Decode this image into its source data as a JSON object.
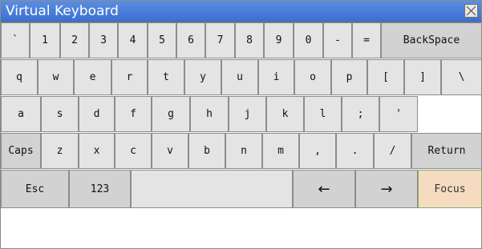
{
  "window": {
    "title": "Virtual Keyboard",
    "close_icon": "close-icon"
  },
  "keyboard": {
    "rows": [
      [
        {
          "id": "backtick",
          "label": "`"
        },
        {
          "id": "1",
          "label": "1"
        },
        {
          "id": "2",
          "label": "2"
        },
        {
          "id": "3",
          "label": "3"
        },
        {
          "id": "4",
          "label": "4"
        },
        {
          "id": "5",
          "label": "5"
        },
        {
          "id": "6",
          "label": "6"
        },
        {
          "id": "7",
          "label": "7"
        },
        {
          "id": "8",
          "label": "8"
        },
        {
          "id": "9",
          "label": "9"
        },
        {
          "id": "0",
          "label": "0"
        },
        {
          "id": "minus",
          "label": "-"
        },
        {
          "id": "equals",
          "label": "="
        },
        {
          "id": "backspace",
          "label": "BackSpace",
          "special": true
        }
      ],
      [
        {
          "id": "q",
          "label": "q"
        },
        {
          "id": "w",
          "label": "w"
        },
        {
          "id": "e",
          "label": "e"
        },
        {
          "id": "r",
          "label": "r"
        },
        {
          "id": "t",
          "label": "t"
        },
        {
          "id": "y",
          "label": "y"
        },
        {
          "id": "u",
          "label": "u"
        },
        {
          "id": "i",
          "label": "i"
        },
        {
          "id": "o",
          "label": "o"
        },
        {
          "id": "p",
          "label": "p"
        },
        {
          "id": "left-bracket",
          "label": "["
        },
        {
          "id": "right-bracket",
          "label": "]"
        },
        {
          "id": "backslash",
          "label": "\\"
        }
      ],
      [
        {
          "id": "a",
          "label": "a"
        },
        {
          "id": "s",
          "label": "s"
        },
        {
          "id": "d",
          "label": "d"
        },
        {
          "id": "f",
          "label": "f"
        },
        {
          "id": "g",
          "label": "g"
        },
        {
          "id": "h",
          "label": "h"
        },
        {
          "id": "j",
          "label": "j"
        },
        {
          "id": "k",
          "label": "k"
        },
        {
          "id": "l",
          "label": "l"
        },
        {
          "id": "semicolon",
          "label": ";"
        },
        {
          "id": "quote",
          "label": "'"
        }
      ],
      [
        {
          "id": "caps",
          "label": "Caps",
          "special": true
        },
        {
          "id": "z",
          "label": "z"
        },
        {
          "id": "x",
          "label": "x"
        },
        {
          "id": "c",
          "label": "c"
        },
        {
          "id": "v",
          "label": "v"
        },
        {
          "id": "b",
          "label": "b"
        },
        {
          "id": "n",
          "label": "n"
        },
        {
          "id": "m",
          "label": "m"
        },
        {
          "id": "comma",
          "label": ","
        },
        {
          "id": "period",
          "label": "."
        },
        {
          "id": "slash",
          "label": "/"
        },
        {
          "id": "return",
          "label": "Return",
          "special": true
        }
      ],
      [
        {
          "id": "esc",
          "label": "Esc",
          "special": true
        },
        {
          "id": "123",
          "label": "123",
          "special": true
        },
        {
          "id": "space",
          "label": ""
        },
        {
          "id": "arrow-left",
          "label": "←",
          "special": true,
          "arrow": true
        },
        {
          "id": "arrow-right",
          "label": "→",
          "special": true,
          "arrow": true
        },
        {
          "id": "focus",
          "label": "Focus",
          "focus": true
        }
      ]
    ]
  }
}
